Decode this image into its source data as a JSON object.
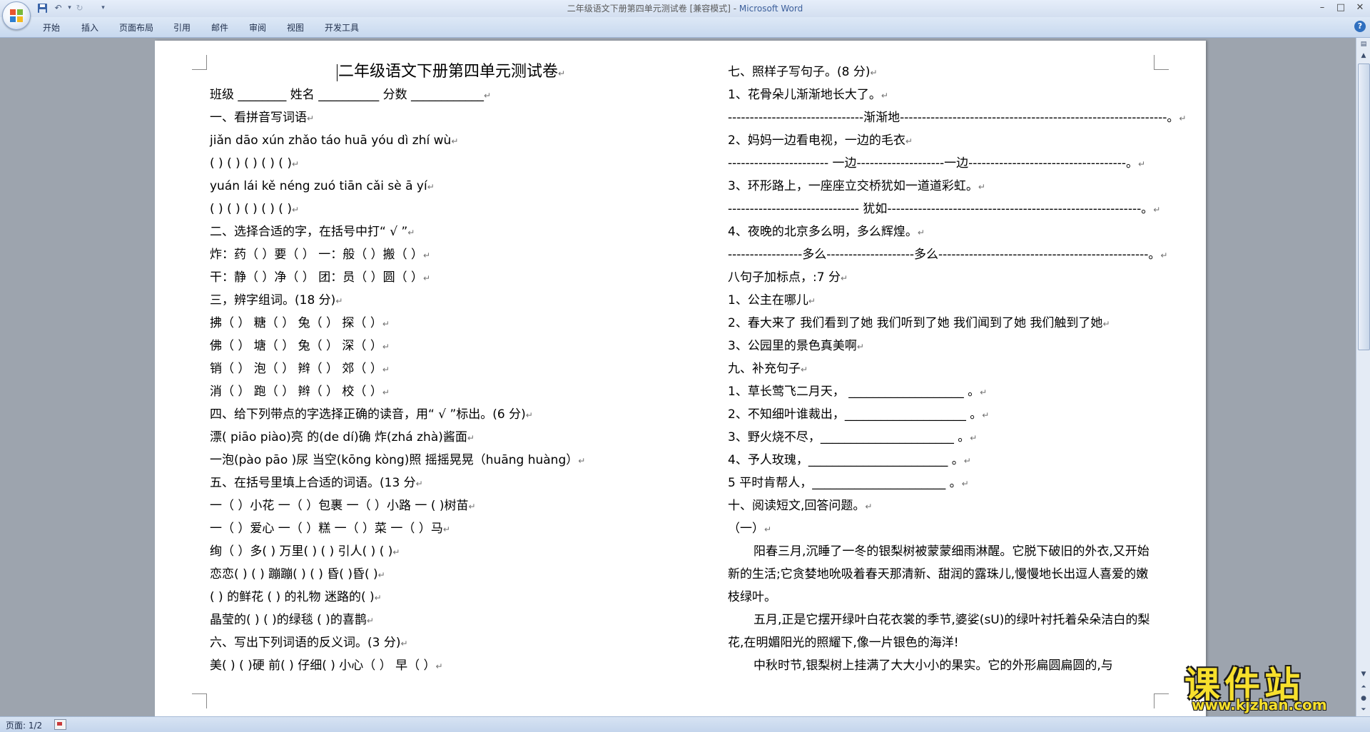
{
  "window": {
    "doc_name": "二年级语文下册第四单元测试卷 [兼容模式] - ",
    "app_name": "Microsoft Word",
    "controls": {
      "minimize": "–",
      "maximize": "□",
      "close": "✕"
    }
  },
  "quick_access": {
    "save_icon": "floppy-disk-icon",
    "undo_icon": "undo-icon",
    "redo_icon": "redo-icon",
    "customize": "▾"
  },
  "ribbon_tabs": [
    "开始",
    "插入",
    "页面布局",
    "引用",
    "邮件",
    "审阅",
    "视图",
    "开发工具"
  ],
  "status": {
    "page": "页面: 1/2"
  },
  "watermark": {
    "text": "课件站",
    "url": "www.kjzhan.com"
  },
  "doc": {
    "title": "二年级语文下册第四单元测试卷",
    "left_lines": [
      "班级 ________                    姓名 __________              分数 ____________",
      "一、看拼音写词语",
      "jiǎn dāo     xún zhǎo      táo huā      yóu dì       zhí    wù",
      "(          )   (          )      (          )     (          )     (          )",
      "yuán lái     kě   néng     zuó tiān     cǎi sè       ā     yí",
      "(          )   (          )      (          )     (          )     (          )",
      "二、选择合适的字，在括号中打“ √ ”",
      "炸：药（ ）要（ ）    一：般（ ）搬（ ）",
      "干：静（ ）净（ ）    团：员（ ）圆（ ）",
      "三，辨字组词。(18 分)",
      "拂（      ）    糖（      ）    兔（        ）   探（      ）",
      "佛（      ）    塘（      ）    兔（        ）   深（      ）",
      "销（      ）    泡（      ）    辫（        ）   郊（      ）",
      "消（      ）    跑（      ）    辫（        ）   校（      ）",
      "四、给下列带点的字选择正确的读音，用“ √ ”标出。(6 分)",
      "漂( piāo piào)亮              的(de      dí)确         炸(zhá  zhà)酱面",
      "一泡(pào   pāo )尿    当空(kōng kòng)照  摇摇晃晃（huāng   huàng）",
      "五、在括号里填上合适的词语。(13 分",
      "一（      ）小花      一（     ）包裹       一（    ）小路     一 (       )树苗",
      "一（      ）爱心      一（     ）糕           一（    ）菜       一（     ）马",
      "绚（     ）多(      )             万里(      ) (      )               引人(      ) (        )",
      "恋恋(      ) (      )             蹦蹦(      ) (      )           昏(        )昏(          )",
      " (       ) 的鲜花               (          ) 的礼物         迷路的(          )",
      "晶莹的(          )                 (          )的绿毯           (          )的喜鹊",
      "六、写出下列词语的反义词。(3 分)",
      "美(     )     (     )硬    前(      )       仔细(      )    小心（      ）      早（     ）"
    ],
    "right_lines": [
      "七、照样子写句子。(8 分)",
      "1、花骨朵儿渐渐地长大了。",
      "   -------------------------------渐渐地-------------------------------------------------------------。",
      "2、妈妈一边看电视，一边的毛衣",
      "   ----------------------- 一边--------------------一边------------------------------------。",
      "3、环形路上，一座座立交桥犹如一道道彩虹。",
      "   ------------------------------ 犹如----------------------------------------------------------。",
      "4、夜晚的北京多么明，多么辉煌。",
      "  -----------------多么--------------------多么------------------------------------------------。",
      "八句子加标点，:7 分",
      "1、公主在哪儿",
      "2、春大来了 我们看到了她  我们听到了她  我们闻到了她  我们触到了她",
      "3、公园里的景色真美啊",
      "九、补充句子",
      "1、草长莺飞二月天，    ___________________    。",
      "2、不知细叶谁裁出，____________________    。",
      "3、野火烧不尽，______________________    。",
      "4、予人玫瑰，_______________________    。",
      "5 平时肯帮人，______________________    。",
      "十、阅读短文,回答问题。",
      "                                        （一）"
    ],
    "paragraphs": [
      "阳春三月,沉睡了一冬的银梨树被蒙蒙细雨淋醒。它脱下破旧的外衣,又开始新的生活;它贪婪地吮吸着春天那清新、甜润的露珠儿,慢慢地长出逗人喜爱的嫩枝绿叶。",
      "五月,正是它摆开绿叶白花衣裳的季节,婆娑(sU)的绿叶衬托着朵朵洁白的梨花,在明媚阳光的照耀下,像一片银色的海洋!",
      "中秋时节,银梨树上挂满了大大小小的果实。它的外形扁圆扁圆的,与"
    ]
  }
}
